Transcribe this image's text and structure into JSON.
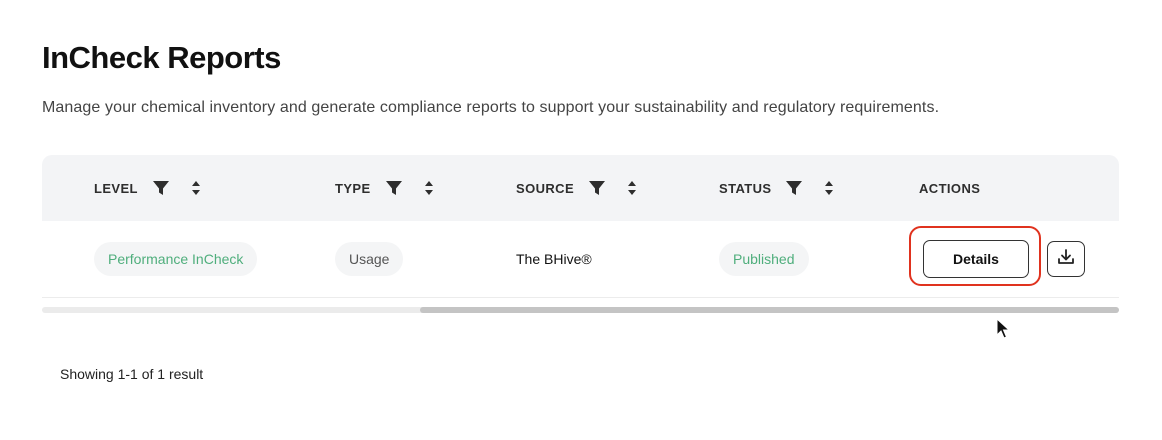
{
  "header": {
    "title": "InCheck Reports",
    "subtitle": "Manage your chemical inventory and generate compliance reports to support your sustainability and regulatory requirements."
  },
  "table": {
    "columns": [
      {
        "label": "LEVEL",
        "filter": true,
        "sort": true
      },
      {
        "label": "TYPE",
        "filter": true,
        "sort": true
      },
      {
        "label": "SOURCE",
        "filter": true,
        "sort": true
      },
      {
        "label": "STATUS",
        "filter": true,
        "sort": true
      },
      {
        "label": "ACTIONS",
        "filter": false,
        "sort": false
      }
    ],
    "rows": [
      {
        "level": "Performance InCheck",
        "type": "Usage",
        "source": "The BHive®",
        "status": "Published",
        "actions": {
          "details_label": "Details",
          "download_icon": "download-icon"
        }
      }
    ]
  },
  "footer": {
    "result_text": "Showing 1-1 of 1 result"
  },
  "colors": {
    "status_green": "#4fae7c",
    "highlight_red": "#e0321e",
    "header_bg": "#f3f4f6"
  }
}
